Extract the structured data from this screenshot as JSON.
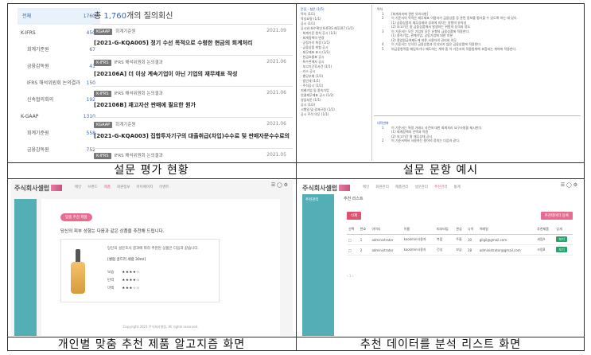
{
  "captions": {
    "panel1": "설문 평가 현황",
    "panel2": "설문 문항 예시",
    "panel3": "개인별 맞춤 추천 제품 알고지즘 화면",
    "panel4": "추천 데이터를 분석 리스트 화면"
  },
  "panel1": {
    "sidebar": [
      {
        "label": "전체",
        "count": "1760",
        "kind": "active"
      },
      {
        "label": "K-IFRS",
        "count": "450",
        "kind": "group"
      },
      {
        "label": "회계기준원",
        "count": "67",
        "kind": "sub"
      },
      {
        "label": "금융감독원",
        "count": "41",
        "kind": "sub"
      },
      {
        "label": "IFRS 해석위원회 논의결과",
        "count": "150",
        "kind": "sub"
      },
      {
        "label": "신속협의회의",
        "count": "192",
        "kind": "sub"
      },
      {
        "label": "K-GAAP",
        "count": "1310",
        "kind": "group"
      },
      {
        "label": "회계기준원",
        "count": "558",
        "kind": "sub"
      },
      {
        "label": "금융감독원",
        "count": "752",
        "kind": "sub"
      },
      {
        "label": "신속협의회의",
        "count": "6",
        "kind": "sub"
      }
    ],
    "title_prefix": "총",
    "title_count": "1,760",
    "title_suffix": "개의 질의회신",
    "items": [
      {
        "badge": "KGAAP",
        "category": "회계기준원",
        "date": "2021.09",
        "title": "[2021-G-KQA005] 정기 수선 목적으로 수령한 현금의 회계처리"
      },
      {
        "badge": "K-IFRS",
        "category": "IFRS 해석위원회 논의결과",
        "date": "2021.06",
        "title": "[202106A] 더 이상 계속기업이 아닌 기업의 재무제표 작성"
      },
      {
        "badge": "K-IFRS",
        "category": "IFRS 해석위원회 논의결과",
        "date": "2021.06",
        "title": "[202106B] 재고자산 판매에 필요한 원가"
      },
      {
        "badge": "KGAAP",
        "category": "회계기준원",
        "date": "2021.06",
        "title": "[2021-G-KQA003] 집합투자기구의 대출취급(차입)수수료 및 판매자문수수료의 회계처..."
      },
      {
        "badge": "K-IFRS",
        "category": "IFRS 해석위원회 논의결과",
        "date": "2021.05",
        "title": "[202105B] 클라우드 컴퓨팅의 배분"
      }
    ]
  },
  "panel2": {
    "tree": [
      "문장 - 설문 (1/5)",
      "목차 (1/1)",
      "작성요령 (1/1)",
      "공시 (1/1)",
      "공시와 회수확인 K-IFRS 제1107 (1/1)",
      " · 회계기준 원칙 공시 (1/1)",
      "   · 회계정책의 변경",
      "   · 공정가치 측정 (1/1)",
      "   · 금융상품 위험 공시",
      "   · 재무제표 표시 (1/1)",
      "   · 현금흐름표 공시",
      "   · 특수관계자 공시",
      " · 보고기간후사건 (1/1)",
      " · 리스 공시",
      " · 충당부채 (1/1)",
      "   · 법인세 (1/1)",
      " · 주석공시 (1/1)",
      "지배기업 및 종속기업",
      "연결재무제표 공시 (1/2)",
      "영업부문 (1/1)",
      "공시 (1/2)",
      "시행일 및 경과규정 (1/1)",
      "공시 주석 의무 (1/1)"
    ],
    "top_header": "목차",
    "top_rows": [
      {
        "k": "1",
        "text": "[회계처리에 관한 유의사항]"
      },
      {
        "k": "2",
        "text": "이 기준서의 목적은 재무제표 이용자가 금융상품 등 관련 정보를 평가할 수 있도록 하는 데 있다."
      },
      {
        "k": "",
        "text": "(1) 금융상품의 재무상태와 성과에 미치는 영향의 유의성"
      },
      {
        "k": "",
        "text": "(2) 보고기간 중 금융상품에서 발생하는 위험의 성격과 정도"
      },
      {
        "k": "3",
        "text": "이 기준서는 모든 기업의 모든 유형의 금융상품에 적용한다."
      },
      {
        "k": "",
        "text": "(1) 종속기업, 관계기업, 공동기업에 대한 지분"
      },
      {
        "k": "",
        "text": "(2) 종업원급여제도에 따른 사용자의 권리와 의무"
      },
      {
        "k": "4",
        "text": "이 기준서는 인식된 금융상품과 인식되지 않은 금융상품에 적용한다."
      },
      {
        "k": "5",
        "text": "비금융항목을 매입하거나 매도하는 계약 중 이 기준서의 적용범위에 포함되는 계약에 적용한다."
      }
    ],
    "bottom_header": "내적변화",
    "bottom_rows": [
      {
        "k": "1",
        "text": "이 기준서는 특정 거래나 사건에 대한 회계처리 요구사항을 제시한다."
      },
      {
        "k": "",
        "text": "(1) 회계정책의 선택과 적용"
      },
      {
        "k": "",
        "text": "(2) 보고기간 말 재무상태 공시"
      },
      {
        "k": "2",
        "text": "이 기준서에서 사용하는 용어의 정의는 다음과 같다."
      }
    ]
  },
  "panel3": {
    "logo": "주식회사셀럽",
    "nav": [
      "메인",
      "브랜드",
      "제품",
      "회원정보",
      "마이페이지",
      "이벤트"
    ],
    "nav_active": 2,
    "icons": "☰ ◯ ⚙",
    "pill": "맞춤 추천 제품",
    "headline": "당신의 피부 성향는 다음과 같은 상품을 추천해 드립니다.",
    "card_desc": "당신의 설문조사 결과에 따라 추천된 상품은 다음과 같습니다.",
    "product_name": "[셀럽 골드러 세럼 30ml]",
    "ratings": [
      {
        "label": "보습",
        "stars": "★★★★☆"
      },
      {
        "label": "탄력",
        "stars": "★★★★☆"
      },
      {
        "label": "미백",
        "stars": "★★★☆☆"
      }
    ],
    "footer": "Copyright 2021 주식회사셀럽. All rights reserved."
  },
  "panel4": {
    "logo": "주식회사셀럽",
    "nav": [
      "메인",
      "회원관리",
      "제품관리",
      "설문관리",
      "추천관리",
      "통계"
    ],
    "nav_active": 4,
    "icons": "☰ ◯ ⚙",
    "sidebar_label": "추천관리",
    "head": "추천 리스트",
    "btn_delete": "삭제",
    "btn_add": "추천데이터 등록",
    "columns": [
      "선택",
      "번호",
      "아이디",
      "이름",
      "피부타입",
      "관심",
      "나이",
      "이메일",
      "추천제품",
      "상세"
    ],
    "rows": [
      [
        "□",
        "1",
        "administrator",
        "kookmin사용자",
        "복합",
        "주름",
        "30",
        "gilgil@gmail.com",
        "세럼A",
        "보기"
      ],
      [
        "□",
        "2",
        "administrator",
        "kookmin사용자",
        "건성",
        "보습",
        "28",
        "administrator@gmail.com",
        "크림B",
        "보기"
      ]
    ],
    "pager": "‹ 1 ›"
  }
}
